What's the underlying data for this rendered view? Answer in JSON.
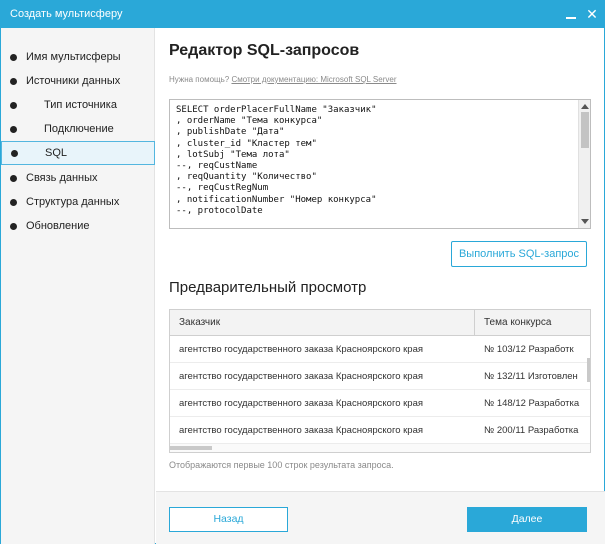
{
  "window": {
    "title": "Создать мультисферу"
  },
  "sidebar": {
    "items": [
      {
        "label": "Имя мультисферы"
      },
      {
        "label": "Источники данных"
      },
      {
        "label": "Тип источника"
      },
      {
        "label": "Подключение"
      },
      {
        "label": "SQL"
      },
      {
        "label": "Связь данных"
      },
      {
        "label": "Структура данных"
      },
      {
        "label": "Обновление"
      }
    ]
  },
  "editor": {
    "title": "Редактор SQL-запросов",
    "help_prefix": "Нужна помощь? ",
    "help_link": "Смотри документацию: Microsoft SQL Server",
    "sql": "SELECT orderPlacerFullName \"Заказчик\"\n, orderName \"Тема конкурса\"\n, publishDate \"Дата\"\n, cluster_id \"Кластер тем\"\n, lotSubj \"Тема лота\"\n--, reqCustName\n, reqQuantity \"Количество\"\n--, reqCustRegNum\n, notificationNumber \"Номер конкурса\"\n--, protocolDate",
    "run_label": "Выполнить SQL-запрос"
  },
  "preview": {
    "title": "Предварительный просмотр",
    "columns": [
      "Заказчик",
      "Тема конкурса"
    ],
    "rows": [
      [
        "агентство государственного заказа Красноярского края",
        "№ 103/12 Разработк"
      ],
      [
        "агентство государственного заказа Красноярского края",
        "№ 132/11 Изготовлен"
      ],
      [
        "агентство государственного заказа Красноярского края",
        "№ 148/12 Разработка"
      ],
      [
        "агентство государственного заказа Красноярского края",
        "№ 200/11 Разработка"
      ]
    ],
    "note": "Отображаются первые 100 строк результата запроса."
  },
  "footer": {
    "back_label": "Назад",
    "next_label": "Далее"
  },
  "colors": {
    "accent": "#2aa8d8",
    "sidebar_bg": "#f5f5f5"
  }
}
